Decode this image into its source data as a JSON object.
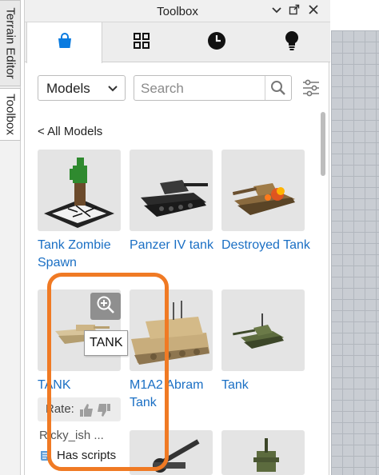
{
  "side_tabs": [
    "Terrain Editor",
    "Toolbox"
  ],
  "window": {
    "title": "Toolbox"
  },
  "tabs": [
    {
      "icon": "bag-icon",
      "active": true
    },
    {
      "icon": "grid-icon",
      "active": false
    },
    {
      "icon": "clock-icon",
      "active": false
    },
    {
      "icon": "lightbulb-icon",
      "active": false
    }
  ],
  "filters": {
    "category": "Models",
    "search_placeholder": "Search"
  },
  "breadcrumb": "< All Models",
  "items": [
    {
      "name": "Tank Zombie Spawn"
    },
    {
      "name": "Panzer IV tank"
    },
    {
      "name": "Destroyed Tank"
    },
    {
      "name": "TANK"
    },
    {
      "name": "M1A2 Abram Tank"
    },
    {
      "name": "Tank"
    }
  ],
  "hovered_item": {
    "tooltip": "TANK",
    "rate_label": "Rate:",
    "creator": "Ricky_ish ...",
    "scripts_label": "Has scripts"
  },
  "colors": {
    "accent": "#0a7be0",
    "link": "#1a6fc4",
    "highlight": "#f07a24"
  }
}
